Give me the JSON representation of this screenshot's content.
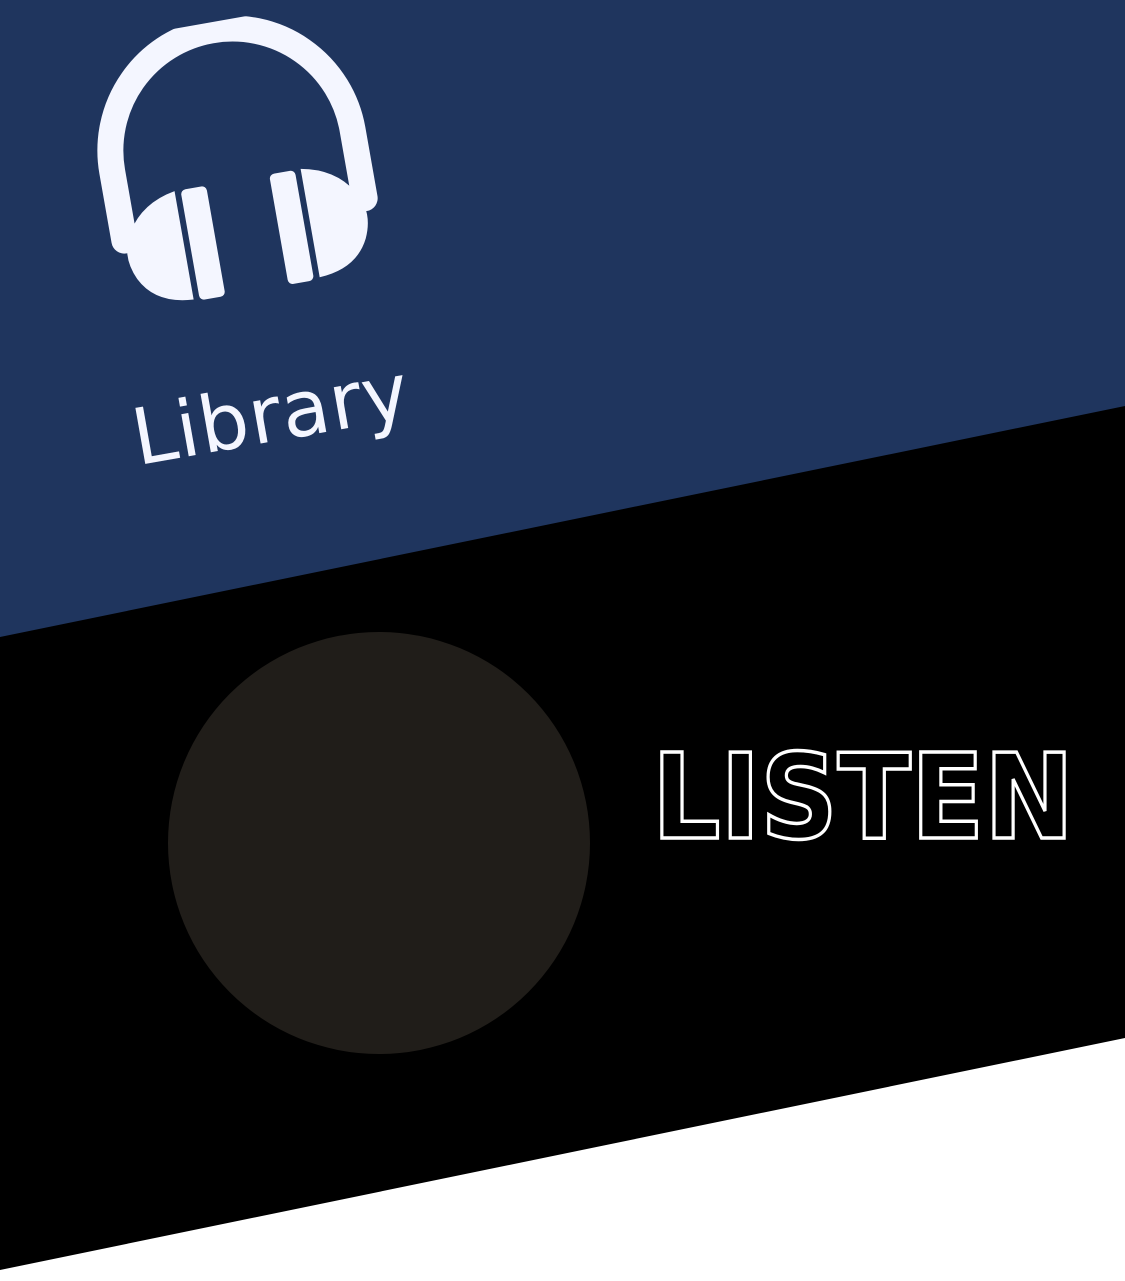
{
  "library": {
    "label": "Library",
    "icon": "headphones-icon"
  },
  "listen": {
    "label": "LISTEN"
  },
  "colors": {
    "library_band": "#1f355e",
    "listen_band": "#000000",
    "background": "#ffffff",
    "disc": "#201d19",
    "icon": "#f4f6ff",
    "listen_outline": "#ffffff"
  }
}
